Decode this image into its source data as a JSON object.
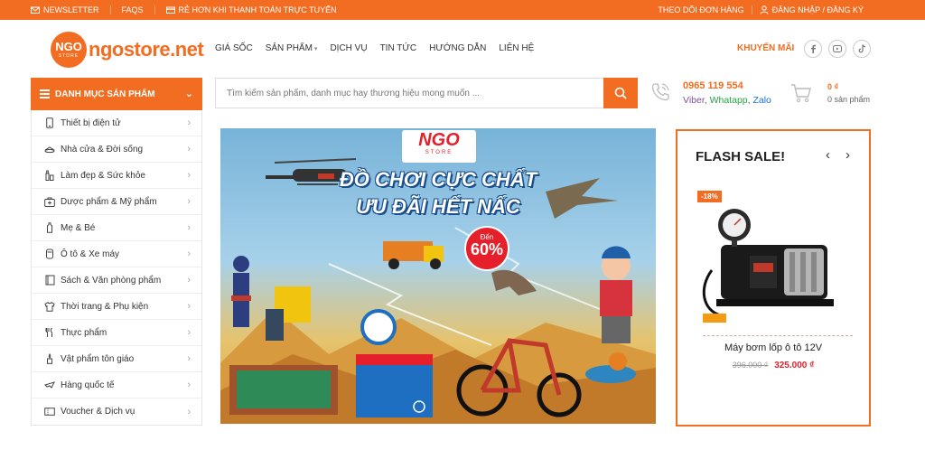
{
  "topbar": {
    "newsletter": "NEWSLETTER",
    "faqs": "FAQS",
    "promo_text": "RẺ HƠN KHI THANH TOÁN TRỰC TUYẾN",
    "track_order": "THEO DÕI ĐƠN HÀNG",
    "login": "ĐĂNG NHẬP / ĐĂNG KÝ"
  },
  "header": {
    "logo_mark": "NGO",
    "logo_sub": "STORE",
    "logo_text": "ngostore.net",
    "nav": [
      {
        "label": "GIÁ SỐC"
      },
      {
        "label": "SẢN PHẨM"
      },
      {
        "label": "DỊCH VỤ"
      },
      {
        "label": "TIN TỨC"
      },
      {
        "label": "HƯỚNG DẪN"
      },
      {
        "label": "LIÊN HỆ"
      }
    ],
    "promo_link": "KHUYẾN MÃI",
    "social": [
      "facebook-icon",
      "youtube-icon",
      "tiktok-icon"
    ]
  },
  "categories": {
    "title": "DANH MỤC SẢN PHẨM",
    "items": [
      {
        "label": "Thiết bị điện tử",
        "icon": "phone-icon"
      },
      {
        "label": "Nhà cửa & Đời sống",
        "icon": "home-icon"
      },
      {
        "label": "Làm đẹp & Sức khỏe",
        "icon": "cosmetics-icon"
      },
      {
        "label": "Dược phẩm & Mỹ phẩm",
        "icon": "medicine-icon"
      },
      {
        "label": "Mẹ & Bé",
        "icon": "baby-bottle-icon"
      },
      {
        "label": "Ô tô & Xe máy",
        "icon": "car-icon"
      },
      {
        "label": "Sách & Văn phòng phẩm",
        "icon": "book-icon"
      },
      {
        "label": "Thời trang & Phụ kiện",
        "icon": "shirt-icon"
      },
      {
        "label": "Thực phẩm",
        "icon": "food-icon"
      },
      {
        "label": "Vật phẩm tôn giáo",
        "icon": "religion-icon"
      },
      {
        "label": "Hàng quốc tế",
        "icon": "plane-icon"
      },
      {
        "label": "Voucher & Dịch vụ",
        "icon": "voucher-icon"
      }
    ]
  },
  "search": {
    "placeholder": "Tìm kiếm sản phẩm, danh mục hay thương hiệu mong muốn ..."
  },
  "contact": {
    "phone": "0965 119 554",
    "viber": "Viber",
    "whatsapp": "Whatapp",
    "zalo": "Zalo",
    "sep": ", "
  },
  "cart": {
    "total": "0 ₫",
    "count": "0 sản phẩm"
  },
  "banner": {
    "logo": "NGO",
    "logo_sub": "STORE",
    "headline1": "ĐỒ CHƠI CỰC CHẤT",
    "headline2": "ƯU ĐÃI HẾT NẤC",
    "badge_prefix": "Đến",
    "badge_value": "60%"
  },
  "flash_sale": {
    "title": "FLASH SALE!",
    "discount": "-18%",
    "product_name": "Máy bơm lốp ô tô 12V",
    "old_price": "396.000 ₫",
    "new_price": "325.000 ₫"
  },
  "colors": {
    "accent": "#f26d21",
    "sale_red": "#e5202a"
  }
}
